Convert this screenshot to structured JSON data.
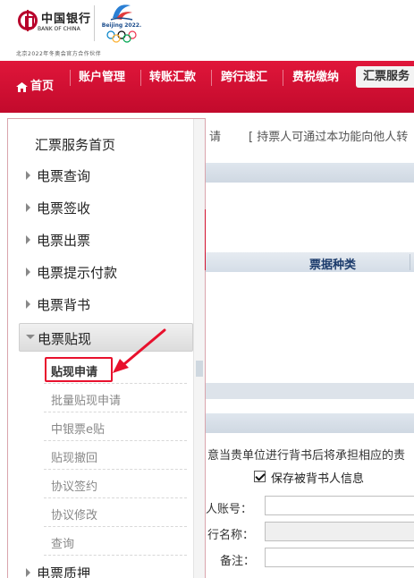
{
  "header": {
    "bank_name_cn": "中国银行",
    "bank_name_en": "BANK OF CHINA",
    "olympic_text": "Beijing 2022.",
    "slogan": "北京2022年冬奥会官方合作伙伴"
  },
  "nav": {
    "home": "首页",
    "items": [
      "账户管理",
      "转账汇款",
      "跨行速汇",
      "费税缴纳"
    ],
    "active": "汇票服务"
  },
  "menu": {
    "home": "汇票服务首页",
    "items": [
      "电票查询",
      "电票签收",
      "电票出票",
      "电票提示付款",
      "电票背书"
    ],
    "expanded": "电票贴现",
    "sub_items": [
      "贴现申请",
      "批量贴现申请",
      "中银票e贴",
      "贴现撤回",
      "协议签约",
      "协议修改",
      "查询"
    ],
    "next": "电票质押"
  },
  "main": {
    "title_tail": "请",
    "title_desc": "[ 持票人可通过本功能向他人转",
    "column_header": "票据种类",
    "hint": "意当贵单位进行背书后将承担相应的责",
    "save_checkbox_label": "保存被背书人信息",
    "checkbox_checked": true,
    "labels": {
      "account": "人账号：",
      "bank_name": "行名称：",
      "remark": "备注："
    }
  },
  "colors": {
    "brand_red": "#c8102e",
    "highlight_red": "#e8112d"
  }
}
